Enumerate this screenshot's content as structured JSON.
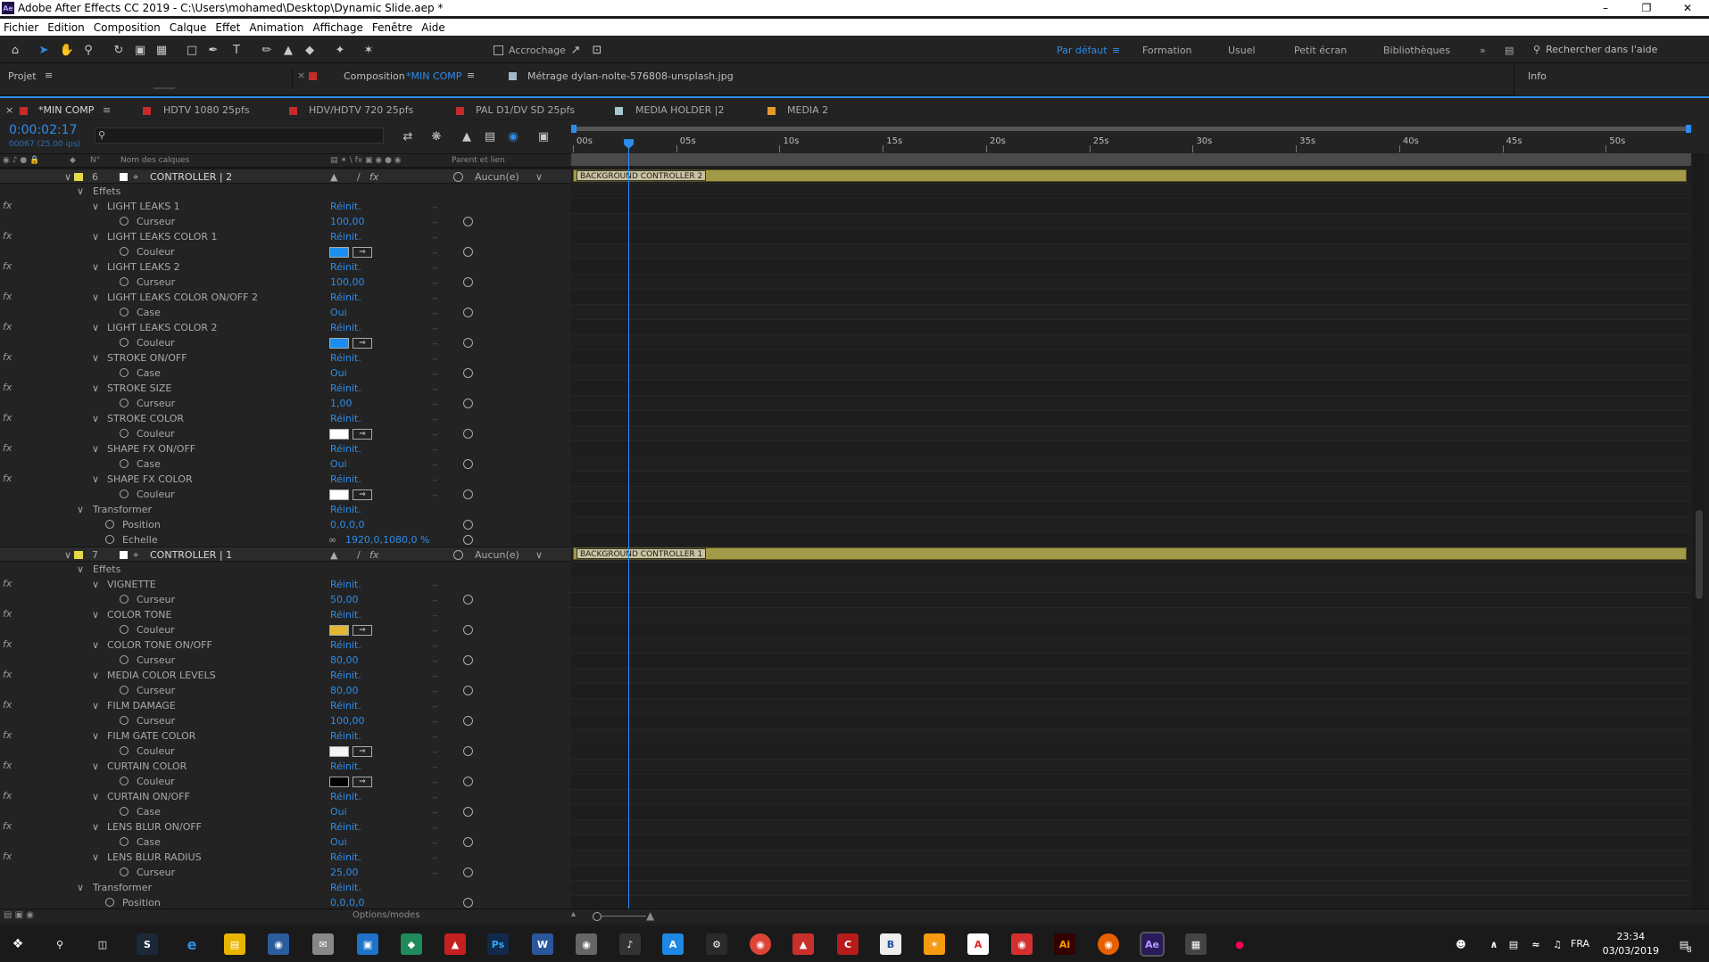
{
  "window": {
    "title": "Adobe After Effects CC 2019 - C:\\Users\\mohamed\\Desktop\\Dynamic Slide.aep *",
    "app_icon": "Ae"
  },
  "menu": [
    "Fichier",
    "Edition",
    "Composition",
    "Calque",
    "Effet",
    "Animation",
    "Affichage",
    "Fenêtre",
    "Aide"
  ],
  "toolbar": {
    "snap_label": "Accrochage",
    "workspaces": [
      "Par défaut",
      "Formation",
      "Usuel",
      "Petit écran",
      "Bibliothèques"
    ],
    "active_workspace": "Par défaut",
    "search_placeholder": "Rechercher dans l'aide"
  },
  "panels": {
    "project": "Projet",
    "composition_prefix": "Composition",
    "composition_name": "*MIN COMP",
    "footage_prefix": "Métrage",
    "footage_name": "dylan-nolte-576808-unsplash.jpg",
    "info": "Info"
  },
  "timeline_tabs": [
    {
      "label": "*MIN COMP",
      "color": "#c62a2a"
    },
    {
      "label": "HDTV 1080 25pfs",
      "color": "#c62a2a"
    },
    {
      "label": "HDV/HDTV 720 25pfs",
      "color": "#c62a2a"
    },
    {
      "label": "PAL D1/DV SD 25pfs",
      "color": "#c62a2a"
    },
    {
      "label": "MEDIA HOLDER |2",
      "color": "#a6c9cf"
    },
    {
      "label": "MEDIA 2",
      "color": "#e39b2c"
    }
  ],
  "timecode": "0:00:02:17",
  "timecode_sub": "00067 (25.00 ips)",
  "columns": {
    "number": "N°",
    "layer_name": "Nom des calques",
    "parent": "Parent et lien"
  },
  "ruler": [
    "00s",
    "05s",
    "10s",
    "15s",
    "20s",
    "25s",
    "30s",
    "35s",
    "40s",
    "45s",
    "50s"
  ],
  "playhead_seconds": 2.68,
  "ruler_max_seconds": 54,
  "reset_label": "Réinit.",
  "layer1": {
    "number": "6",
    "name": "CONTROLLER | 2",
    "parent": "Aucun(e)",
    "bar_label": "BACKGROUND CONTROLLER 2",
    "effects_label": "Effets",
    "transform_label": "Transformer",
    "effects": [
      {
        "name": "LIGHT LEAKS  1",
        "prop": "Curseur",
        "value": "100,00"
      },
      {
        "name": "LIGHT LEAKS  COLOR 1",
        "prop": "Couleur",
        "color": "#1a8ff0"
      },
      {
        "name": "LIGHT LEAKS  2",
        "prop": "Curseur",
        "value": "100,00"
      },
      {
        "name": "LIGHT LEAKS COLOR ON/OFF 2",
        "prop": "Case",
        "value": "Oui"
      },
      {
        "name": "LIGHT LEAKS  COLOR 2",
        "prop": "Couleur",
        "color": "#1a8ff0"
      },
      {
        "name": "STROKE ON/OFF",
        "prop": "Case",
        "value": "Oui"
      },
      {
        "name": "STROKE SIZE",
        "prop": "Curseur",
        "value": "1,00"
      },
      {
        "name": "STROKE COLOR",
        "prop": "Couleur",
        "color": "#ffffff"
      },
      {
        "name": "SHAPE FX ON/OFF",
        "prop": "Case",
        "value": "Oui"
      },
      {
        "name": "SHAPE FX COLOR",
        "prop": "Couleur",
        "color": "#ffffff"
      }
    ],
    "transform": [
      {
        "prop": "Position",
        "value": "0,0,0,0"
      },
      {
        "prop": "Echelle",
        "value": "1920,0,1080,0 %"
      }
    ]
  },
  "layer2": {
    "number": "7",
    "name": "CONTROLLER | 1",
    "parent": "Aucun(e)",
    "bar_label": "BACKGROUND CONTROLLER 1",
    "effects_label": "Effets",
    "transform_label": "Transformer",
    "effects": [
      {
        "name": "VIGNETTE",
        "prop": "Curseur",
        "value": "50,00"
      },
      {
        "name": "COLOR TONE",
        "prop": "Couleur",
        "color": "#e0b833"
      },
      {
        "name": "COLOR TONE  ON/OFF",
        "prop": "Curseur",
        "value": "80,00"
      },
      {
        "name": "MEDIA COLOR LEVELS",
        "prop": "Curseur",
        "value": "80,00"
      },
      {
        "name": "FILM DAMAGE",
        "prop": "Curseur",
        "value": "100,00"
      },
      {
        "name": "FILM GATE COLOR",
        "prop": "Couleur",
        "color": "#f4f4f4"
      },
      {
        "name": "CURTAIN COLOR",
        "prop": "Couleur",
        "color": "#000000"
      },
      {
        "name": "CURTAIN ON/OFF",
        "prop": "Case",
        "value": "Oui"
      },
      {
        "name": "LENS BLUR ON/OFF",
        "prop": "Case",
        "value": "Oui"
      },
      {
        "name": "LENS BLUR RADIUS",
        "prop": "Curseur",
        "value": "25,00"
      }
    ],
    "transform": [
      {
        "prop": "Position",
        "value": "0,0,0,0"
      }
    ]
  },
  "bottom": {
    "options_label": "Options/modes"
  },
  "taskbar": {
    "language": "FRA",
    "time": "23:34",
    "date": "03/03/2019",
    "notifications": "8"
  },
  "colors": {
    "accent": "#2d8ceb",
    "layer_label_yellow": "#e6d84a",
    "layer_bar": "#a39a47"
  }
}
